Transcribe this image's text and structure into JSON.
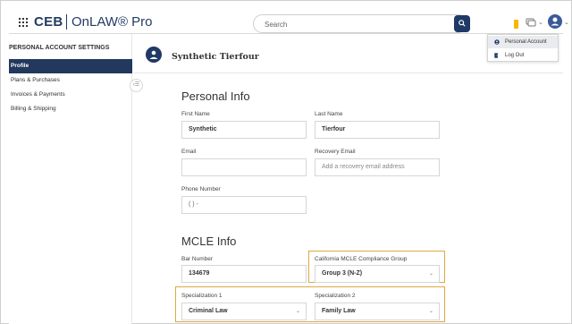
{
  "header": {
    "brand_ceb": "CEB",
    "brand_onlaw": "OnLAW® Pro",
    "search_placeholder": "Search"
  },
  "user_menu": {
    "items": [
      {
        "label": "Personal Account"
      },
      {
        "label": "Log Out"
      }
    ]
  },
  "sidebar": {
    "title": "PERSONAL ACCOUNT SETTINGS",
    "items": [
      {
        "label": "Profile",
        "active": true
      },
      {
        "label": "Plans & Purchases"
      },
      {
        "label": "Invoices & Payments"
      },
      {
        "label": "Billing & Shipping"
      }
    ]
  },
  "profile": {
    "name": "Synthetic Tierfour"
  },
  "personal_info": {
    "title": "Personal Info",
    "first_name_label": "First Name",
    "first_name_value": "Synthetic",
    "last_name_label": "Last Name",
    "last_name_value": "Tierfour",
    "email_label": "Email",
    "email_value": "",
    "recovery_email_label": "Recovery Email",
    "recovery_email_placeholder": "Add a recovery email address",
    "phone_label": "Phone Number",
    "phone_placeholder": "(  )  -"
  },
  "mcle_info": {
    "title": "MCLE Info",
    "bar_number_label": "Bar Number",
    "bar_number_value": "134679",
    "compliance_group_label": "California MCLE Compliance Group",
    "compliance_group_value": "Group 3 (N-Z)",
    "specialization1_label": "Specialization 1",
    "specialization1_value": "Criminal Law",
    "specialization2_label": "Specialization 2",
    "specialization2_value": "Family Law"
  },
  "colors": {
    "navy": "#22385d",
    "bookmark": "#f5b800",
    "highlight": "#e0a840"
  }
}
